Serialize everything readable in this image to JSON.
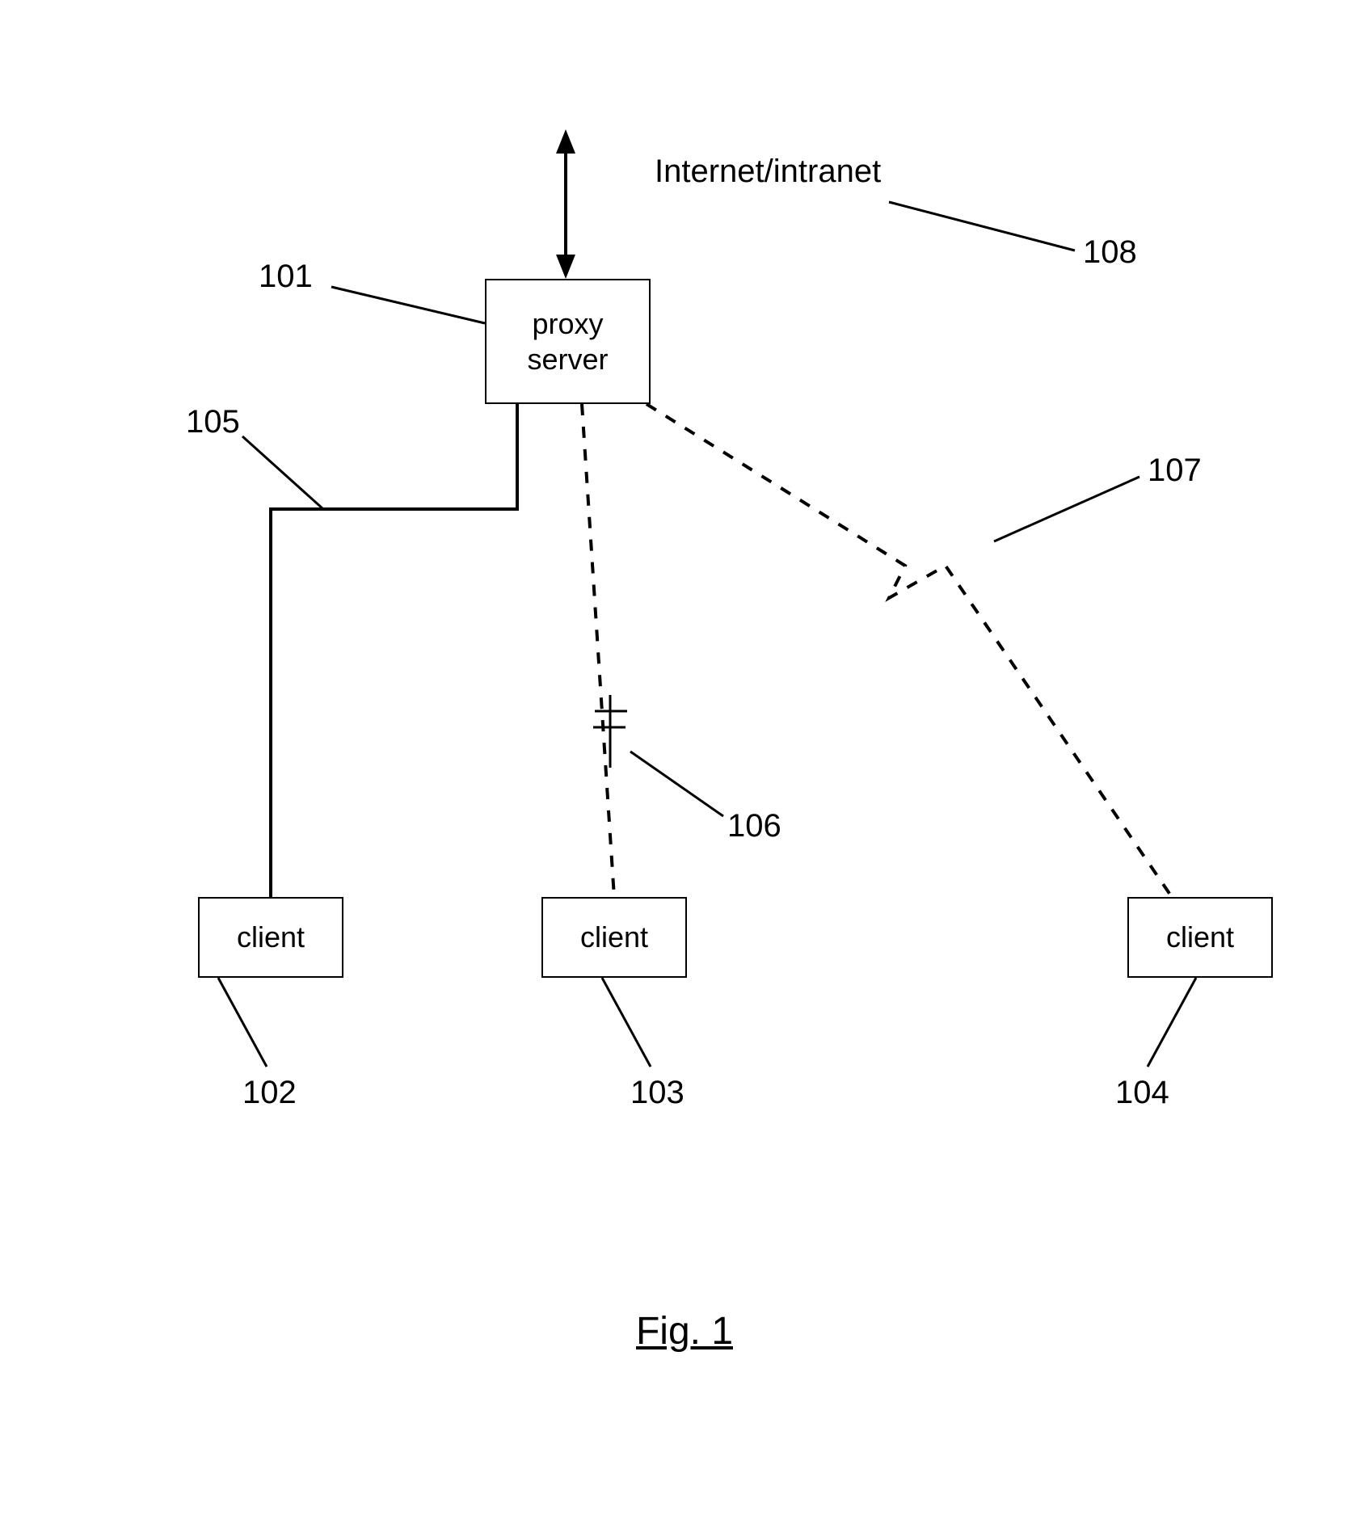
{
  "diagram": {
    "title": "Fig. 1",
    "network_label": "Internet/intranet",
    "nodes": {
      "proxy_server": {
        "label": "proxy\nserver",
        "ref": "101"
      },
      "client_a": {
        "label": "client",
        "ref": "102"
      },
      "client_b": {
        "label": "client",
        "ref": "103"
      },
      "client_c": {
        "label": "client",
        "ref": "104"
      }
    },
    "links": {
      "wired": {
        "ref": "105",
        "style": "solid"
      },
      "wireless_short": {
        "ref": "106",
        "style": "dashed"
      },
      "wireless_long": {
        "ref": "107",
        "style": "dashed"
      },
      "internet_uplink": {
        "ref": "108",
        "style": "solid_double_arrow"
      }
    }
  },
  "chart_data": {
    "type": "diagram",
    "kind": "network-topology",
    "title": "Fig. 1",
    "nodes": [
      {
        "id": "internet",
        "label": "Internet/intranet",
        "ref": "108"
      },
      {
        "id": "proxy",
        "label": "proxy server",
        "ref": "101"
      },
      {
        "id": "clientA",
        "label": "client",
        "ref": "102"
      },
      {
        "id": "clientB",
        "label": "client",
        "ref": "103"
      },
      {
        "id": "clientC",
        "label": "client",
        "ref": "104"
      }
    ],
    "edges": [
      {
        "from": "proxy",
        "to": "internet",
        "ref": "108",
        "style": "solid",
        "bidirectional": true
      },
      {
        "from": "proxy",
        "to": "clientA",
        "ref": "105",
        "style": "solid"
      },
      {
        "from": "proxy",
        "to": "clientB",
        "ref": "106",
        "style": "dashed"
      },
      {
        "from": "proxy",
        "to": "clientC",
        "ref": "107",
        "style": "dashed"
      }
    ]
  }
}
